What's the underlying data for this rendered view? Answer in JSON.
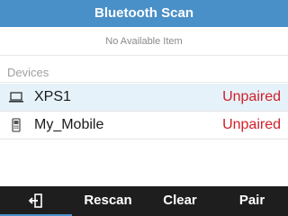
{
  "title": "Bluetooth Scan",
  "status_message": "No Available Item",
  "devices_section": {
    "label": "Devices",
    "items": [
      {
        "name": "XPS1",
        "status": "Unpaired",
        "icon": "laptop-icon",
        "selected": true
      },
      {
        "name": "My_Mobile",
        "status": "Unpaired",
        "icon": "phone-icon",
        "selected": false
      }
    ]
  },
  "softkeys": {
    "back_icon": "back-icon",
    "rescan": "Rescan",
    "clear": "Clear",
    "pair": "Pair"
  },
  "colors": {
    "title_bar": "#4a90c8",
    "unpaired": "#d0202a",
    "selected_row": "#e6f2fa",
    "softkey_bar": "#1e1e1e"
  }
}
